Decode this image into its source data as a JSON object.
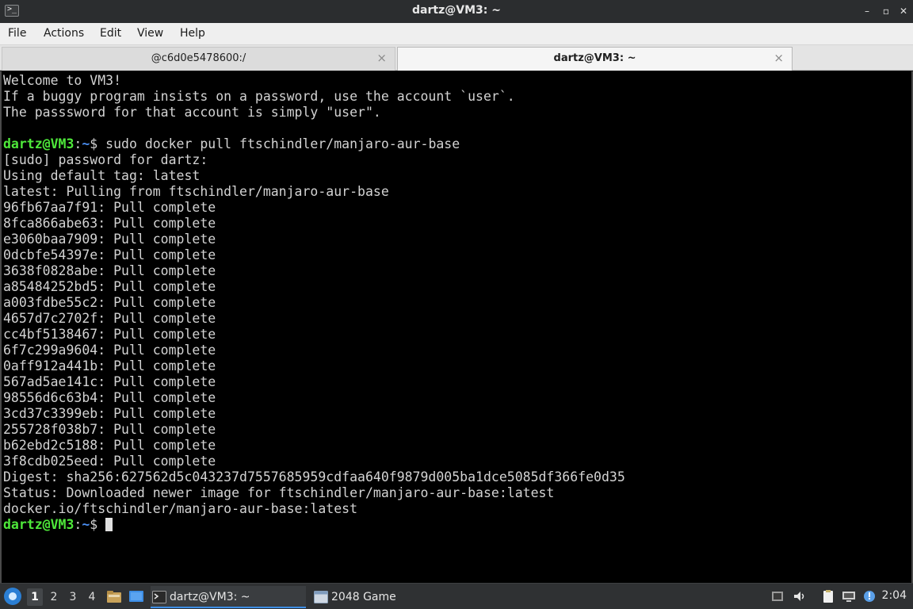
{
  "window": {
    "title": "dartz@VM3: ~",
    "minimize_glyph": "–",
    "maximize_glyph": "▫",
    "close_glyph": "✕"
  },
  "menubar": {
    "items": [
      "File",
      "Actions",
      "Edit",
      "View",
      "Help"
    ]
  },
  "tabs": [
    {
      "label": "@c6d0e5478600:/",
      "close": "×",
      "active": false
    },
    {
      "label": "dartz@VM3: ~",
      "close": "×",
      "active": true
    }
  ],
  "terminal": {
    "prompt_user": "dartz@VM3",
    "prompt_sep": ":",
    "prompt_path": "~",
    "prompt_symbol": "$ ",
    "lines": [
      {
        "text": "Welcome to VM3!"
      },
      {
        "text": "If a buggy program insists on a password, use the account `user`."
      },
      {
        "text": "The passsword for that account is simply \"user\"."
      },
      {
        "text": ""
      },
      {
        "prompt": true,
        "text": "sudo docker pull ftschindler/manjaro-aur-base"
      },
      {
        "text": "[sudo] password for dartz:"
      },
      {
        "text": "Using default tag: latest"
      },
      {
        "text": "latest: Pulling from ftschindler/manjaro-aur-base"
      },
      {
        "text": "96fb67aa7f91: Pull complete"
      },
      {
        "text": "8fca866abe63: Pull complete"
      },
      {
        "text": "e3060baa7909: Pull complete"
      },
      {
        "text": "0dcbfe54397e: Pull complete"
      },
      {
        "text": "3638f0828abe: Pull complete"
      },
      {
        "text": "a85484252bd5: Pull complete"
      },
      {
        "text": "a003fdbe55c2: Pull complete"
      },
      {
        "text": "4657d7c2702f: Pull complete"
      },
      {
        "text": "cc4bf5138467: Pull complete"
      },
      {
        "text": "6f7c299a9604: Pull complete"
      },
      {
        "text": "0aff912a441b: Pull complete"
      },
      {
        "text": "567ad5ae141c: Pull complete"
      },
      {
        "text": "98556d6c63b4: Pull complete"
      },
      {
        "text": "3cd37c3399eb: Pull complete"
      },
      {
        "text": "255728f038b7: Pull complete"
      },
      {
        "text": "b62ebd2c5188: Pull complete"
      },
      {
        "text": "3f8cdb025eed: Pull complete"
      },
      {
        "text": "Digest: sha256:627562d5c043237d7557685959cdfaa640f9879d005ba1dce5085df366fe0d35"
      },
      {
        "text": "Status: Downloaded newer image for ftschindler/manjaro-aur-base:latest"
      },
      {
        "text": "docker.io/ftschindler/manjaro-aur-base:latest"
      },
      {
        "prompt": true,
        "text": "",
        "cursor": true
      }
    ]
  },
  "taskbar": {
    "workspaces": [
      "1",
      "2",
      "3",
      "4"
    ],
    "active_workspace": 0,
    "tasks": [
      {
        "label": "dartz@VM3: ~"
      },
      {
        "label": "2048 Game"
      }
    ],
    "clock": "2:04"
  },
  "colors": {
    "prompt_user": "#4ee83a",
    "prompt_path": "#4b8ff2",
    "terminal_bg": "#000000",
    "terminal_fg": "#d3d3d3"
  }
}
